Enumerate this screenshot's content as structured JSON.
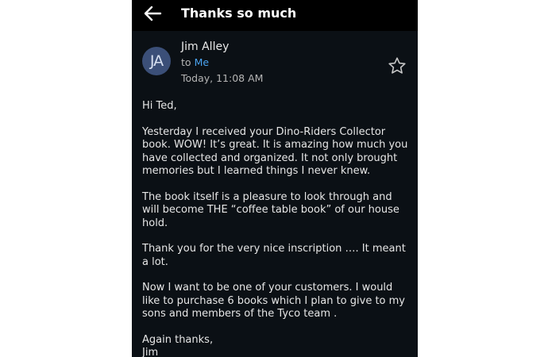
{
  "appbar": {
    "title": "Thanks so much",
    "back_icon": "arrow-left-icon"
  },
  "message": {
    "sender_initials": "JA",
    "sender_name": "Jim Alley",
    "to_prefix": "to",
    "to_recipient": "Me",
    "timestamp": "Today, 11:08 AM",
    "star_icon": "star-outline-icon",
    "paragraphs": [
      "Hi Ted,",
      "Yesterday I received your Dino-Riders Collector book. WOW! It’s great.  It is amazing how much you have collected and organized.  It not only brought memories but I learned things I never knew.",
      "The book itself is a pleasure to look through and will become THE  “coffee table book” of our house hold.",
      "Thank you for the very nice inscription …. It meant a lot.",
      "Now I want to be one of your customers.  I would like to purchase 6 books which I plan to give to my sons and members of the Tyco team .",
      "Again thanks,\nJim"
    ]
  },
  "colors": {
    "background": "#0b1015",
    "appbar": "#000000",
    "accent_link": "#4aa3f0",
    "avatar": "#3b4f78"
  }
}
